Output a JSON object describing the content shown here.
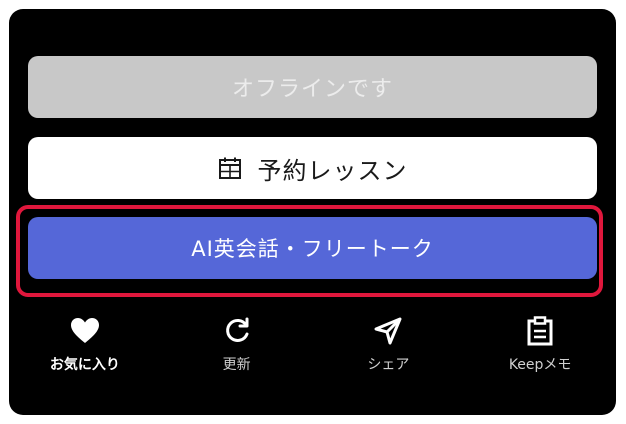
{
  "buttons": {
    "offline": "オフラインです",
    "reserve": "予約レッスン",
    "ai": "AI英会話・フリートーク"
  },
  "nav": [
    {
      "label": "お気に入り",
      "icon": "heart-icon"
    },
    {
      "label": "更新",
      "icon": "refresh-icon"
    },
    {
      "label": "シェア",
      "icon": "send-icon"
    },
    {
      "label": "Keepメモ",
      "icon": "clipboard-icon"
    }
  ],
  "colors": {
    "offline_bg": "#c8c8c8",
    "ai_bg": "#5567d8",
    "highlight": "#e0173c"
  }
}
